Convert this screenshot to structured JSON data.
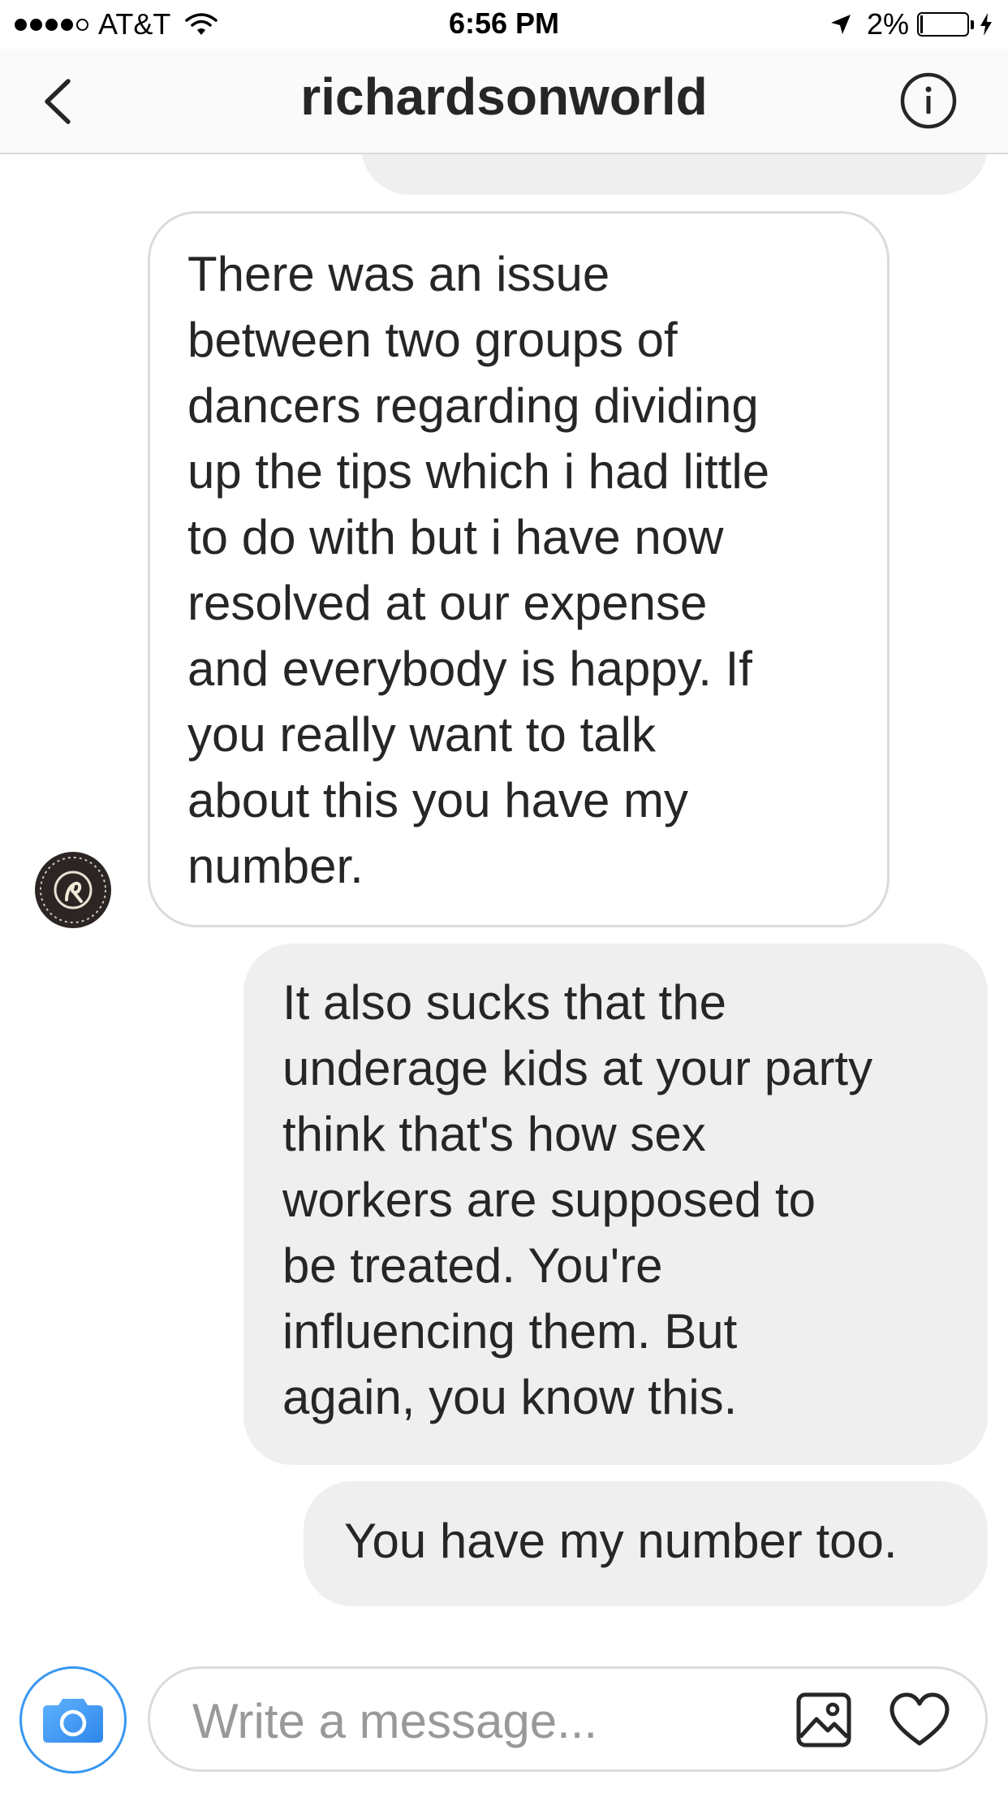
{
  "status_bar": {
    "carrier": "AT&T",
    "signal_bars_filled": 4,
    "signal_bars_total": 5,
    "time": "6:56 PM",
    "battery_percent_label": "2%",
    "battery_level": 0.02,
    "icons": [
      "wifi-icon",
      "location-arrow-icon",
      "battery-icon",
      "charging-bolt-icon"
    ]
  },
  "header": {
    "back_icon": "chevron-left-icon",
    "title": "richardsonworld",
    "info_icon": "info-icon"
  },
  "messages": [
    {
      "direction": "incoming",
      "sender": "richardsonworld",
      "text": "There was an issue\nbetween two groups of\ndancers regarding dividing\nup the tips which i had little\nto do with but i have now\nresolved at our expense\nand everybody is happy. If\nyou really want to talk\nabout this you have my\nnumber."
    },
    {
      "direction": "outgoing",
      "text": "It also sucks that the\nunderage kids at your party\nthink that's how sex\nworkers are supposed to\nbe treated. You're\ninfluencing them. But\nagain, you know this."
    },
    {
      "direction": "outgoing",
      "text": "You have my number too."
    }
  ],
  "composer": {
    "camera_icon": "camera-icon",
    "placeholder": "Write a message...",
    "value": "",
    "gallery_icon": "gallery-icon",
    "heart_icon": "heart-icon"
  },
  "colors": {
    "accent": "#3897f0",
    "outgoing_bubble": "#efefef",
    "incoming_border": "#dbdbdb",
    "text": "#262626",
    "placeholder": "#999999"
  }
}
